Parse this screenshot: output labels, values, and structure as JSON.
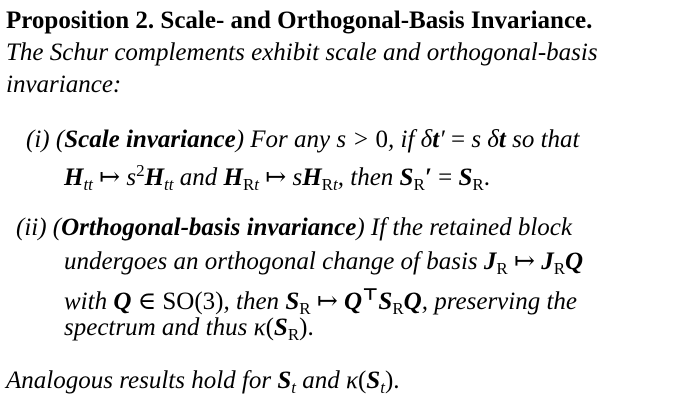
{
  "proposition": {
    "heading": "Proposition 2. Scale- and Orthogonal-Basis Invariance.",
    "intro_line1": "The Schur complements exhibit scale and orthogonal-basis",
    "intro_line2": "invariance:"
  },
  "items": [
    {
      "label": "(i)",
      "title": "Scale invariance",
      "text_for_any": "For any",
      "text_if": ", if",
      "text_so_that": "so that",
      "text_and": "and",
      "text_then": ", then"
    },
    {
      "label": "(ii)",
      "title": "Orthogonal-basis invariance",
      "text_if_retained": "If the retained block",
      "line2": "undergoes an orthogonal change of basis",
      "text_with": "with",
      "text_then": ", then",
      "text_preserving": ", preserving the",
      "line4_pre": "spectrum and thus"
    }
  ],
  "closing": {
    "text_pre": "Analogous results hold for",
    "text_and": "and"
  }
}
